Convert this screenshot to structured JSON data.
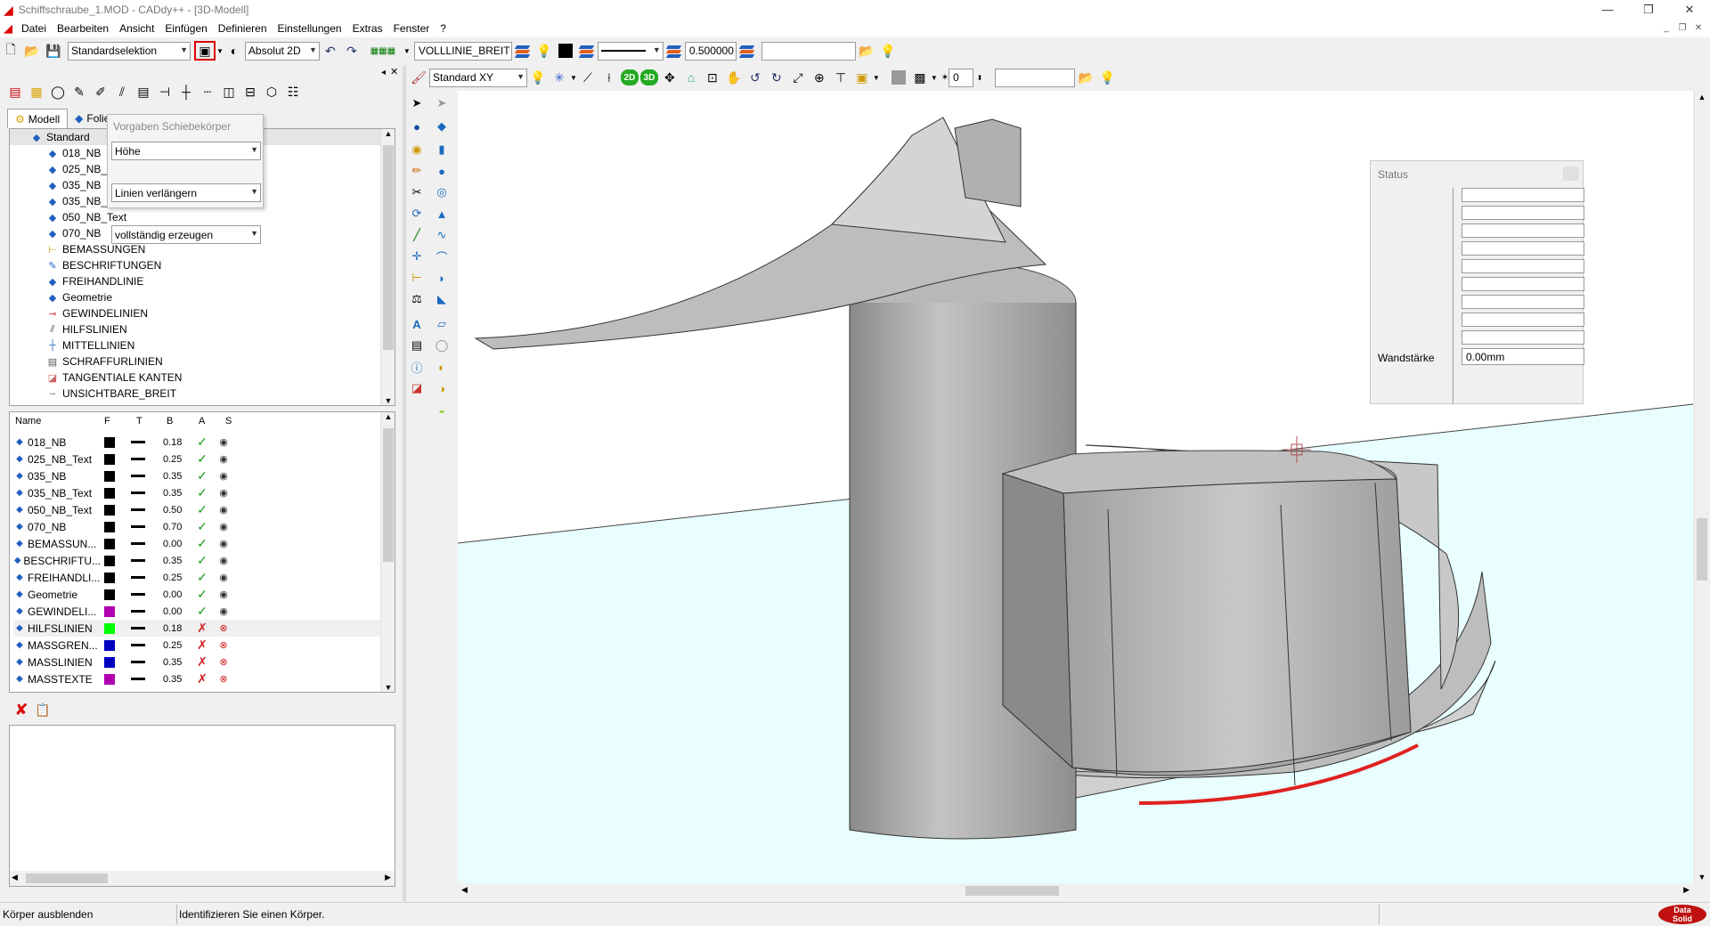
{
  "window": {
    "title": "Schiffschraube_1.MOD  -  CADdy++ - [3D-Modell]"
  },
  "menu": [
    "Datei",
    "Bearbeiten",
    "Ansicht",
    "Einfügen",
    "Definieren",
    "Einstellungen",
    "Extras",
    "Fenster",
    "?"
  ],
  "toolbar1": {
    "selection_mode": "Standardselektion",
    "coord_mode": "Absolut 2D",
    "linetype": "VOLLLINIE_BREIT",
    "line_width": "0.500000",
    "empty_field": ""
  },
  "toolbar2": {
    "view": "Standard XY",
    "layer_value": "0",
    "empty_field": ""
  },
  "tabs": [
    "Modell",
    "Folie"
  ],
  "popup": {
    "title": "Vorgaben Schiebekörper",
    "options": [
      "Höhe",
      "Linien verlängern",
      "vollständig erzeugen"
    ]
  },
  "tree": {
    "root": "Standard",
    "items": [
      {
        "label": "018_NB",
        "icon": "layer-icon"
      },
      {
        "label": "025_NB_",
        "icon": "layer-icon"
      },
      {
        "label": "035_NB",
        "icon": "layer-icon"
      },
      {
        "label": "035_NB_",
        "icon": "layer-icon"
      },
      {
        "label": "050_NB_Text",
        "icon": "layer-icon"
      },
      {
        "label": "070_NB",
        "icon": "layer-icon"
      },
      {
        "label": "BEMASSUNGEN",
        "icon": "dimension-icon"
      },
      {
        "label": "BESCHRIFTUNGEN",
        "icon": "label-icon"
      },
      {
        "label": "FREIHANDLINIE",
        "icon": "layer-icon"
      },
      {
        "label": "Geometrie",
        "icon": "layer-icon"
      },
      {
        "label": "GEWINDELINIEN",
        "icon": "thread-icon"
      },
      {
        "label": "HILFSLINIEN",
        "icon": "helpline-icon"
      },
      {
        "label": "MITTELLINIEN",
        "icon": "centerline-icon"
      },
      {
        "label": "SCHRAFFURLINIEN",
        "icon": "hatch-icon"
      },
      {
        "label": "TANGENTIALE KANTEN",
        "icon": "tangent-icon"
      },
      {
        "label": "UNSICHTBARE_BREIT",
        "icon": "hidden-icon"
      }
    ]
  },
  "layer_table": {
    "headers": [
      "Name",
      "F",
      "T",
      "B",
      "A",
      "S"
    ],
    "rows": [
      {
        "name": "018_NB",
        "color": "#000000",
        "width": "0.18",
        "active": true
      },
      {
        "name": "025_NB_Text",
        "color": "#000000",
        "width": "0.25",
        "active": true
      },
      {
        "name": "035_NB",
        "color": "#000000",
        "width": "0.35",
        "active": true
      },
      {
        "name": "035_NB_Text",
        "color": "#000000",
        "width": "0.35",
        "active": true
      },
      {
        "name": "050_NB_Text",
        "color": "#000000",
        "width": "0.50",
        "active": true
      },
      {
        "name": "070_NB",
        "color": "#000000",
        "width": "0.70",
        "active": true
      },
      {
        "name": "BEMASSUN...",
        "color": "#000000",
        "width": "0.00",
        "active": true
      },
      {
        "name": "BESCHRIFTU...",
        "color": "#000000",
        "width": "0.35",
        "active": true
      },
      {
        "name": "FREIHANDLI...",
        "color": "#000000",
        "width": "0.25",
        "active": true
      },
      {
        "name": "Geometrie",
        "color": "#000000",
        "width": "0.00",
        "active": true
      },
      {
        "name": "GEWINDELI...",
        "color": "#b000b0",
        "width": "0.00",
        "active": true
      },
      {
        "name": "HILFSLINIEN",
        "color": "#00ff00",
        "width": "0.18",
        "active": false
      },
      {
        "name": "MASSGREN...",
        "color": "#0000c0",
        "width": "0.25",
        "active": false
      },
      {
        "name": "MASSLINIEN",
        "color": "#0000c0",
        "width": "0.35",
        "active": false
      },
      {
        "name": "MASSTEXTE",
        "color": "#b000b0",
        "width": "0.35",
        "active": false
      }
    ]
  },
  "status_panel": {
    "title": "Status",
    "field_label": "Wandstärke",
    "field_value": "0.00mm"
  },
  "statusbar": {
    "left": "Körper ausblenden",
    "message": "Identifizieren Sie einen Körper."
  },
  "colors": {
    "viewport_bg": "#e8feff",
    "model_gray": "#a8a8a8",
    "accent_red": "#e02020"
  }
}
